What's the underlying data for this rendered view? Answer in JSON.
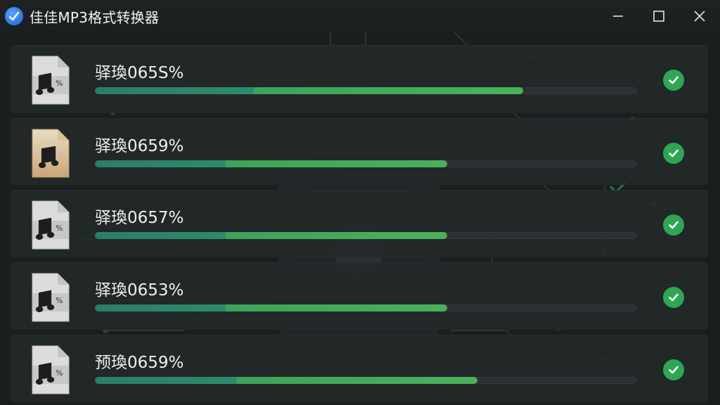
{
  "window": {
    "title": "佳佳MP3格式转换器",
    "controls": [
      "minimize-icon",
      "maximize-icon",
      "close-icon"
    ]
  },
  "colors": {
    "background": "#1a1e1f",
    "row": "#24292a",
    "progress_start": "#2a7e68",
    "progress_end": "#4cb05a",
    "success": "#2fa653",
    "app_icon": "#2f7ff0"
  },
  "files": [
    {
      "name": "驿瑍065S%",
      "progress": 0.79,
      "status": "done",
      "icon": "music-file-percent-icon"
    },
    {
      "name": "驿瑍0659%",
      "progress": 0.65,
      "status": "done",
      "icon": "music-file-gold-icon"
    },
    {
      "name": "驿瑍0657%",
      "progress": 0.65,
      "status": "done",
      "icon": "music-file-percent-icon"
    },
    {
      "name": "驿瑍0653%",
      "progress": 0.65,
      "status": "done",
      "icon": "music-file-percent-icon"
    },
    {
      "name": "预瑍0659%",
      "progress": 0.705,
      "status": "done",
      "icon": "music-file-percent-icon"
    }
  ]
}
